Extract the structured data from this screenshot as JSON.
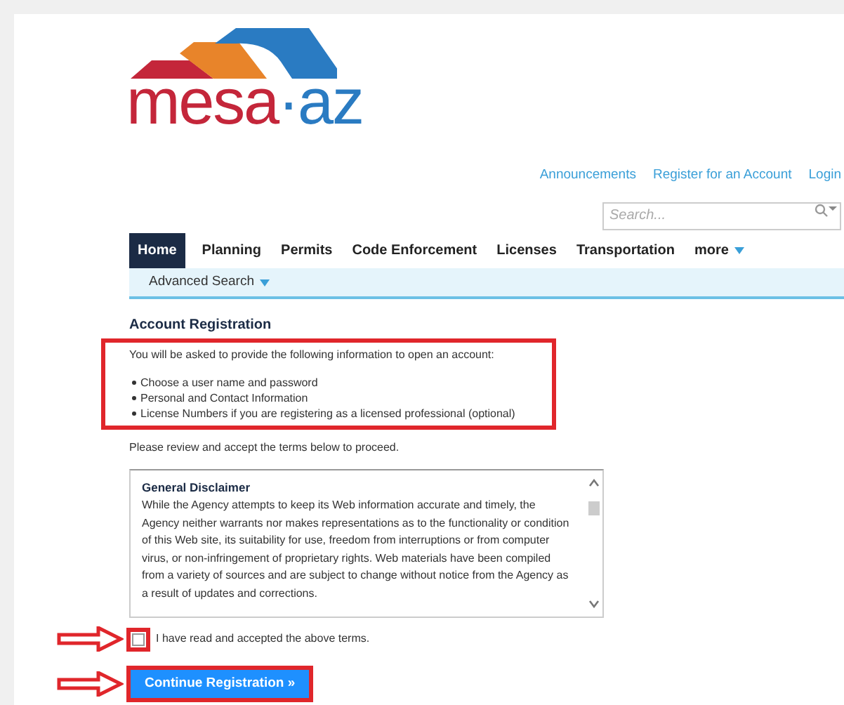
{
  "logo": {
    "word": "mesa",
    "suffix": "·az"
  },
  "top_links": [
    "Announcements",
    "Register for an Account",
    "Login"
  ],
  "search": {
    "placeholder": "Search..."
  },
  "nav": [
    {
      "label": "Home",
      "selected": true
    },
    {
      "label": "Planning",
      "selected": false
    },
    {
      "label": "Permits",
      "selected": false
    },
    {
      "label": "Code Enforcement",
      "selected": false
    },
    {
      "label": "Licenses",
      "selected": false
    },
    {
      "label": "Transportation",
      "selected": false
    },
    {
      "label": "more",
      "selected": false,
      "dropdown": true
    }
  ],
  "subnav": {
    "label": "Advanced Search"
  },
  "heading": "Account Registration",
  "intro": "You will be asked to provide the following information to open an account:",
  "requirements": [
    "Choose a user name and password",
    "Personal and Contact Information",
    "License Numbers if you are registering as a licensed professional (optional)"
  ],
  "instruction": "Please review and accept the terms below to proceed.",
  "terms": {
    "title": "General Disclaimer",
    "body": "While the Agency attempts to keep its Web information accurate and timely, the Agency neither warrants nor makes representations as to the functionality or condition of this Web site, its suitability for use, freedom from interruptions or from computer virus, or non-infringement of proprietary rights. Web materials have been compiled from a variety of sources and are subject to change without notice from the Agency as a result of updates and corrections."
  },
  "accept": {
    "label": "I have read and accepted the above terms.",
    "checked": false
  },
  "continue_button": "Continue Registration »"
}
